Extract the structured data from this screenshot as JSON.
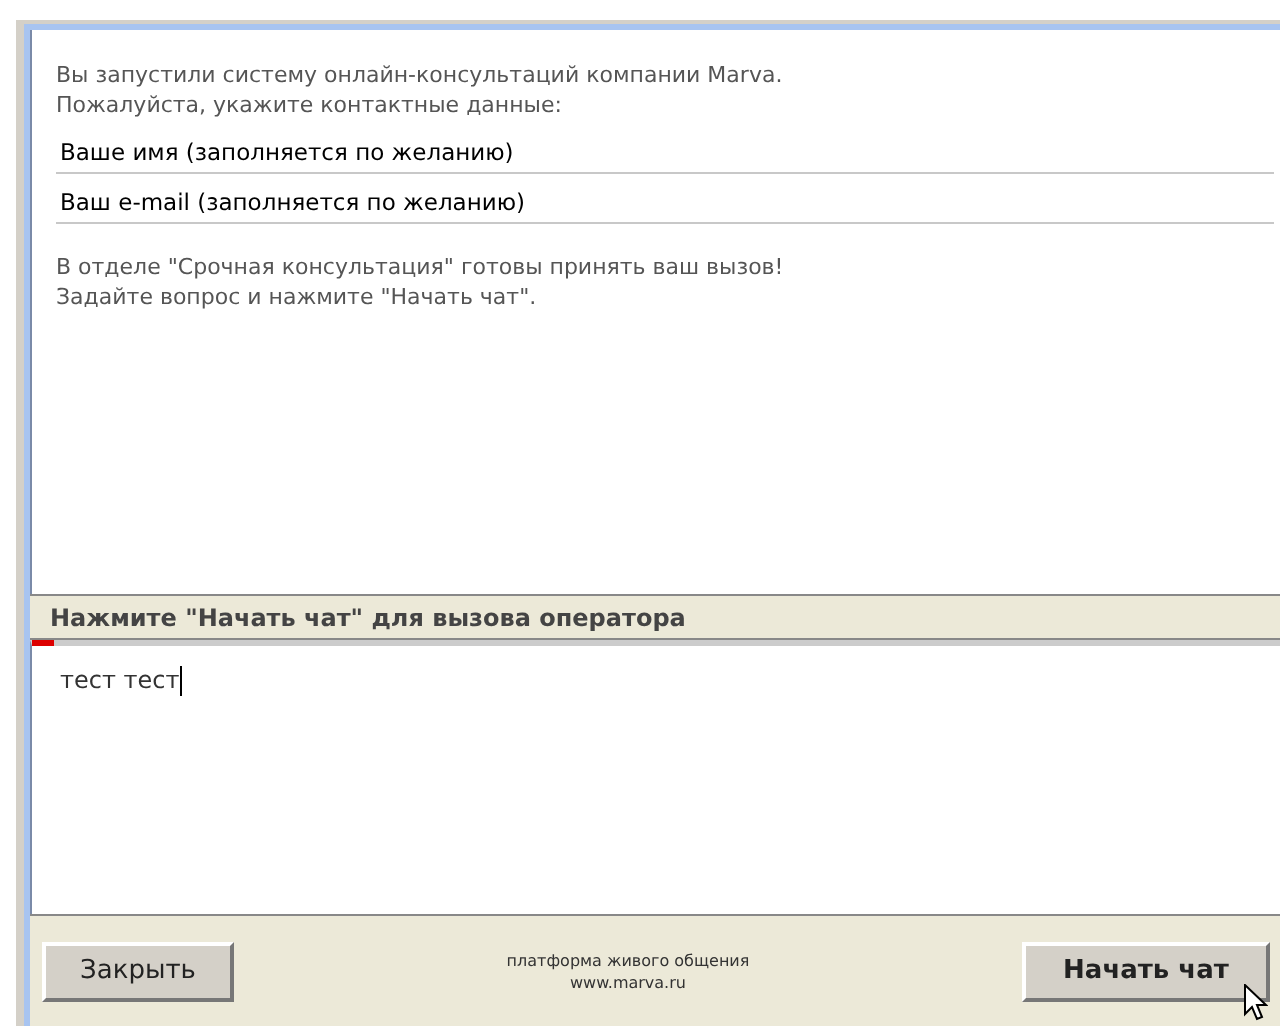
{
  "intro": [
    "Вы запустили систему онлайн-консультаций компании Marva.",
    "Пожалуйста, укажите контактные данные:"
  ],
  "fields": [
    {
      "value": "Ваше имя (заполняется по желанию)"
    },
    {
      "value": "Ваш e-mail (заполняется по желанию)"
    }
  ],
  "notice": [
    "В отделе \"Срочная консультация\" готовы принять ваш вызов!",
    "Задайте вопрос и нажмите \"Начать чат\"."
  ],
  "status_bar": "Нажмите \"Начать чат\" для вызова оператора",
  "message": {
    "value": "тест тест"
  },
  "footer": {
    "close_button": "Закрыть",
    "credit": [
      "платформа живого общения",
      "www.marva.ru"
    ],
    "start_button": "Начать чат"
  }
}
